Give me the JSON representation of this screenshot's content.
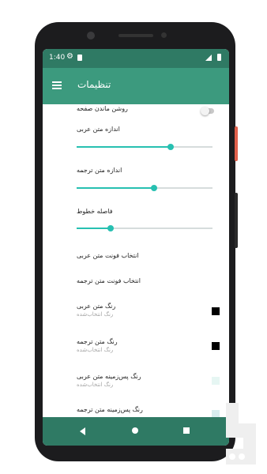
{
  "status_bar": {
    "time": "1:40"
  },
  "app_bar": {
    "title": "تنظیمات"
  },
  "settings": {
    "keep_screen_on": {
      "label": "روشن ماندن صفحه",
      "enabled": false
    },
    "arabic_text_size": {
      "label": "اندازه متن عربی",
      "value": 0.69
    },
    "translation_text_size": {
      "label": "اندازه متن ترجمه",
      "value": 0.57
    },
    "line_spacing": {
      "label": "فاصله خطوط",
      "value": 0.25
    },
    "arabic_font": {
      "label": "انتخاب فونت متن عربی"
    },
    "translation_font": {
      "label": "انتخاب فونت متن ترجمه"
    },
    "arabic_text_color": {
      "label": "رنگ متن عربی",
      "subtitle": "رنگ انتخاب‌شده",
      "color": "#000000"
    },
    "translation_text_color": {
      "label": "رنگ متن ترجمه",
      "subtitle": "رنگ انتخاب‌شده",
      "color": "#000000"
    },
    "arabic_bg_color": {
      "label": "رنگ پس‌زمینه متن عربی",
      "subtitle": "رنگ انتخاب‌شده",
      "color": "#e6f6f3"
    },
    "translation_bg_color": {
      "label": "رنگ پس‌زمینه متن ترجمه",
      "color": "#d7ecee"
    }
  },
  "colors": {
    "status_bar": "#2f7a64",
    "app_bar": "#3c9a7e",
    "accent": "#27c0b1"
  },
  "icons": {
    "menu": "hamburger-menu-icon",
    "status_settings": "gear-icon",
    "status_sd": "sd-card-icon",
    "signal": "signal-icon",
    "battery": "battery-icon",
    "nav_back": "back-triangle-icon",
    "nav_home": "home-circle-icon",
    "nav_recent": "recent-apps-square-icon"
  }
}
